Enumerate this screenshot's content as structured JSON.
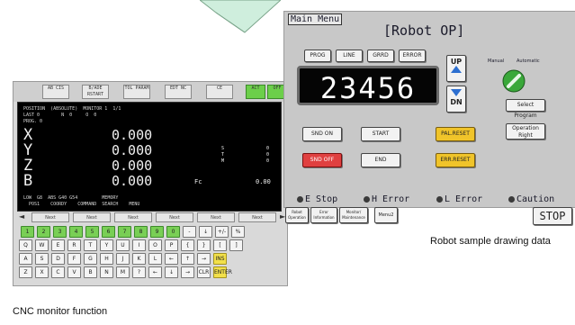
{
  "cnc": {
    "caption": "CNC monitor function",
    "toolbar": [
      "AB CIS",
      "B/ADE\nRSTART",
      "TOL\nPARAM",
      "EDT\nNC",
      "CE",
      "ACT",
      "OFF"
    ],
    "screen": {
      "header": "POSITION  (ABSOLUTE)  MONITOR 1  1/1",
      "header2": "LAST 0        N  0     O  0",
      "header3": "PROG. 0",
      "axes": [
        {
          "axis": "X",
          "value": "0.000"
        },
        {
          "axis": "Y",
          "value": "0.000"
        },
        {
          "axis": "Z",
          "value": "0.000"
        },
        {
          "axis": "B",
          "value": "0.000"
        }
      ],
      "side_s": "S",
      "side_t": "T",
      "side_m": "M",
      "side_vals": "0\n0\n0",
      "fc_label": "Fc",
      "fc_value": "0.00",
      "footer1": "LOW  G8  ABS G40 G54         MEMORY",
      "footer2": "  POS1    COORDY    COMMAND  SEARCH    MENU"
    },
    "softkeys": [
      "Next",
      "Next",
      "Next",
      "Next",
      "Next",
      "Next"
    ],
    "arrows": {
      "left": "◄",
      "right": "►"
    },
    "keyboard": {
      "row1": [
        "1",
        "2",
        "3",
        "4",
        "5",
        "6",
        "7",
        "8",
        "9",
        "0",
        "-",
        "↓",
        "+/-",
        "%"
      ],
      "row2": [
        "Q",
        "W",
        "E",
        "R",
        "T",
        "Y",
        "U",
        "I",
        "O",
        "P",
        "{",
        "}",
        "[",
        "]"
      ],
      "row3": [
        "A",
        "S",
        "D",
        "F",
        "G",
        "H",
        "J",
        "K",
        "L",
        "←",
        "↑",
        "→",
        "INS"
      ],
      "row4": [
        "Z",
        "X",
        "C",
        "V",
        "B",
        "N",
        "M",
        "?",
        "←",
        "↓",
        "→",
        "CLR",
        "ENTER"
      ]
    }
  },
  "robot": {
    "caption": "Robot sample drawing data",
    "main_menu": "Main Menu",
    "title": "[Robot OP]",
    "top_buttons": [
      "PROG",
      "LINE",
      "GRRD",
      "ERROR"
    ],
    "counter": "23456",
    "up": "UP",
    "dn": "DN",
    "manual": "Manual",
    "automatic": "Automatic",
    "select_program": "Select Program",
    "operation_right": "Operation Right",
    "btn_snd_on": "SND ON",
    "btn_start": "START",
    "btn_pal_reset": "PAL.RESET",
    "btn_snd_off": "SND OFF",
    "btn_end": "END",
    "btn_err_reset": "ERR.RESET",
    "indicators": [
      "E Stop",
      "H Error",
      "L Error",
      "Caution"
    ],
    "bottom": [
      "Robot Operation",
      "Error Information",
      "Monitor/ Maintenance",
      "Menu2"
    ],
    "stop": "STOP"
  },
  "colors": {
    "accent_green": "#6ccf4a",
    "accent_yellow": "#f0c42a",
    "alert_red": "#e04040",
    "display_blue": "#2d6fd0"
  }
}
